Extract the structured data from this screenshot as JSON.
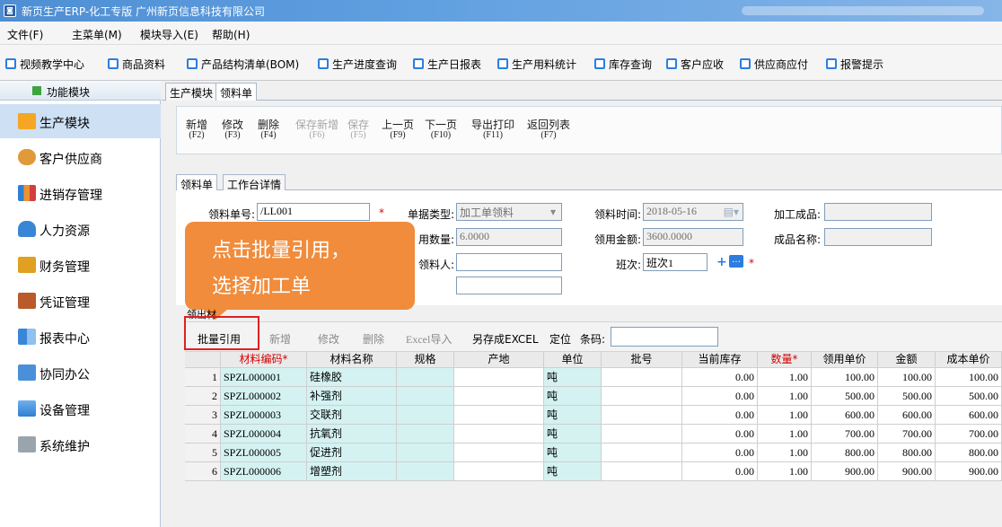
{
  "window": {
    "title": "新页生产ERP-化工专版 广州新页信息科技有限公司"
  },
  "menu": [
    "文件(F)",
    "主菜单(M)",
    "模块导入(E)",
    "帮助(H)"
  ],
  "quick_links": [
    "视频教学中心",
    "商品资料",
    "产品结构清单(BOM)",
    "生产进度查询",
    "生产日报表",
    "生产用料统计",
    "库存查询",
    "客户应收",
    "供应商应付",
    "报警提示"
  ],
  "sidebar": {
    "header": "功能模块",
    "items": [
      "生产模块",
      "客户供应商",
      "进销存管理",
      "人力资源",
      "财务管理",
      "凭证管理",
      "报表中心",
      "协同办公",
      "设备管理",
      "系统维护"
    ]
  },
  "tabs": [
    "生产模块",
    "领料单"
  ],
  "toolbar": [
    {
      "label": "新增",
      "key": "(F2)"
    },
    {
      "label": "修改",
      "key": "(F3)"
    },
    {
      "label": "删除",
      "key": "(F4)"
    },
    {
      "label": "保存新增",
      "key": "(F6)"
    },
    {
      "label": "保存",
      "key": "(F5)"
    },
    {
      "label": "上一页",
      "key": "(F9)"
    },
    {
      "label": "下一页",
      "key": "(F10)"
    },
    {
      "label": "导出打印",
      "key": "(F11)"
    },
    {
      "label": "返回列表",
      "key": "(F7)"
    }
  ],
  "form_tabs": [
    "领料单",
    "工作台详情"
  ],
  "form": {
    "order_no_label": "领料单号:",
    "order_no_value": "/LL001",
    "doc_type_label": "单据类型:",
    "doc_type_value": "加工单领料",
    "time_label": "领料时间:",
    "time_value": "2018-05-16",
    "product_label": "加工成品:",
    "qty_label": "用数量:",
    "qty_value": "6.0000",
    "amount_label": "领用金额:",
    "amount_value": "3600.0000",
    "product_name_label": "成品名称:",
    "picker_label": "领料人:",
    "shift_label": "班次:",
    "shift_value": "班次1",
    "required_mark": "*"
  },
  "callout": [
    "点击批量引用，",
    "选择加工单"
  ],
  "grid_tab": "领出材",
  "grid_toolbar": {
    "batch": "批量引用",
    "add": "新增",
    "edit": "修改",
    "delete": "删除",
    "excel_import": "Excel导入",
    "save_excel": "另存成EXCEL",
    "locate": "定位",
    "barcode": "条码:"
  },
  "grid": {
    "columns": [
      "材料编码*",
      "材料名称",
      "规格",
      "产地",
      "单位",
      "批号",
      "当前库存",
      "数量*",
      "领用单价",
      "金额",
      "成本单价"
    ],
    "rows": [
      {
        "idx": "1",
        "code": "SPZL000001",
        "name": "硅橡胶",
        "unit": "吨",
        "stock": "0.00",
        "qty": "1.00",
        "price": "100.00",
        "amount": "100.00",
        "cost": "100.00"
      },
      {
        "idx": "2",
        "code": "SPZL000002",
        "name": "补强剂",
        "unit": "吨",
        "stock": "0.00",
        "qty": "1.00",
        "price": "500.00",
        "amount": "500.00",
        "cost": "500.00"
      },
      {
        "idx": "3",
        "code": "SPZL000003",
        "name": "交联剂",
        "unit": "吨",
        "stock": "0.00",
        "qty": "1.00",
        "price": "600.00",
        "amount": "600.00",
        "cost": "600.00"
      },
      {
        "idx": "4",
        "code": "SPZL000004",
        "name": "抗氧剂",
        "unit": "吨",
        "stock": "0.00",
        "qty": "1.00",
        "price": "700.00",
        "amount": "700.00",
        "cost": "700.00"
      },
      {
        "idx": "5",
        "code": "SPZL000005",
        "name": "促进剂",
        "unit": "吨",
        "stock": "0.00",
        "qty": "1.00",
        "price": "800.00",
        "amount": "800.00",
        "cost": "800.00"
      },
      {
        "idx": "6",
        "code": "SPZL000006",
        "name": "增塑剂",
        "unit": "吨",
        "stock": "0.00",
        "qty": "1.00",
        "price": "900.00",
        "amount": "900.00",
        "cost": "900.00"
      }
    ]
  },
  "colors": {
    "accent": "#2b7de0",
    "callout": "#f08c3c",
    "highlight": "#e02020",
    "row_blue": "#d5f2f2"
  }
}
